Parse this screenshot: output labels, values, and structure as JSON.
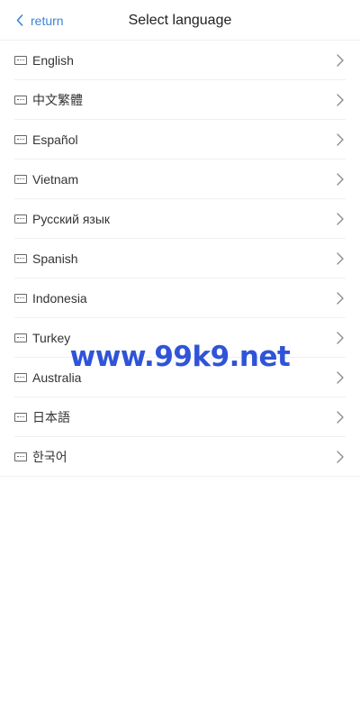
{
  "header": {
    "back_label": "return",
    "title": "Select language"
  },
  "languages": [
    {
      "label": "English"
    },
    {
      "label": "中文繁體"
    },
    {
      "label": "Español"
    },
    {
      "label": "Vietnam"
    },
    {
      "label": "Русский язык"
    },
    {
      "label": "Spanish"
    },
    {
      "label": "Indonesia"
    },
    {
      "label": "Turkey"
    },
    {
      "label": "Australia"
    },
    {
      "label": "日本語"
    },
    {
      "label": "한국어"
    }
  ],
  "watermark": "www.99k9.net",
  "colors": {
    "accent": "#3b84d6",
    "watermark": "#2f54d8",
    "divider": "#f0f0f0"
  },
  "icons": {
    "back": "chevron-left-icon",
    "language": "keyboard-icon",
    "item_arrow": "chevron-right-icon"
  }
}
